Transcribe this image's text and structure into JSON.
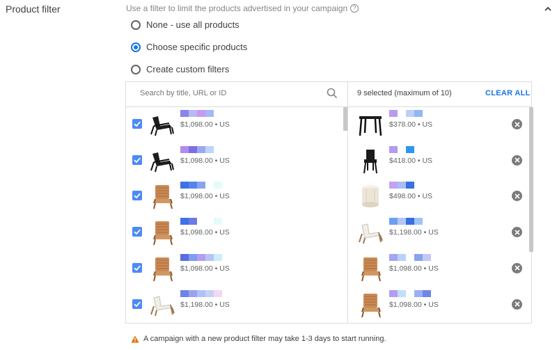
{
  "section": {
    "label": "Product filter",
    "help_text": "Use a filter to limit the products advertised in your campaign"
  },
  "radios": [
    {
      "label": "None - use all products",
      "selected": false
    },
    {
      "label": "Choose specific products",
      "selected": true
    },
    {
      "label": "Create custom filters",
      "selected": false
    }
  ],
  "search": {
    "placeholder": "Search by title, URL or ID"
  },
  "selection": {
    "count_text": "9 selected (maximum of 10)",
    "clear_all": "CLEAR ALL"
  },
  "left_items": [
    {
      "price": "$1,098.00 • US",
      "icon": "black-chair-icon",
      "checked": true,
      "swatches": [
        "#8a85e8",
        "#b6b9f3",
        "#c79af0",
        "#a7b8f7"
      ]
    },
    {
      "price": "$1,098.00 • US",
      "icon": "black-chair-icon",
      "checked": true,
      "swatches": [
        "#b38bf0",
        "#7d6fe0",
        "#9aa8f4",
        "#bcd6fb"
      ]
    },
    {
      "price": "$1,098.00 • US",
      "icon": "woven-chair-icon",
      "checked": true,
      "swatches": [
        "#3f72e4",
        "#5684ea",
        "#8ba3ef",
        "#ffffff",
        "#e4fbfa"
      ]
    },
    {
      "price": "$1,098.00 • US",
      "icon": "woven-chair-icon",
      "checked": true,
      "swatches": [
        "#3f72e4",
        "#6b7be6",
        "#ffffff",
        "#ffffff",
        "#e4fbfa"
      ]
    },
    {
      "price": "$1,098.00 • US",
      "icon": "woven-chair-icon",
      "checked": true,
      "swatches": [
        "#5a6ee0",
        "#7f9cf0",
        "#b49ef2",
        "#b8c2f7",
        "#cceefc"
      ]
    },
    {
      "price": "$1,198.00 • US",
      "icon": "white-chair-icon",
      "checked": true,
      "swatches": [
        "#6b84e8",
        "#9aa3f0",
        "#b0c3f5",
        "#c7d0f9",
        "#f4d8f2"
      ]
    }
  ],
  "right_items": [
    {
      "price": "$378.00 • US",
      "icon": "black-table-icon",
      "swatches": [
        "#b89cf2",
        "#ffffff",
        "#bcd0f8",
        "#8fb8f5"
      ]
    },
    {
      "price": "$418.00 • US",
      "icon": "black-side-chair-icon",
      "swatches": [
        "#b49af0",
        "#ffffff",
        "#2d96f0"
      ]
    },
    {
      "price": "$498.00 • US",
      "icon": "white-round-ottoman-icon",
      "swatches": [
        "#c2a2f3",
        "#a8bcf6",
        "#3a6fe0"
      ]
    },
    {
      "price": "$1,198.00 • US",
      "icon": "white-chair-icon",
      "swatches": [
        "#6aa0f0",
        "#b5c6f5",
        "#3a6fe0",
        "#9ec4f7"
      ]
    },
    {
      "price": "$1,098.00 • US",
      "icon": "woven-chair-icon",
      "swatches": [
        "#a7a3f2",
        "#b8d2f8",
        "#ffffff",
        "#8ba3ef",
        "#c3c9f7"
      ]
    },
    {
      "price": "$1,098.00 • US",
      "icon": "woven-chair-icon",
      "swatches": [
        "#b59cf2",
        "#bfe0f9",
        "#ffffff",
        "#9ab0f4",
        "#6f86e6"
      ]
    }
  ],
  "warning": {
    "text": "A campaign with a new product filter may take 1-3 days to start running."
  },
  "colors": {
    "accent": "#1a73e8",
    "checkbox": "#4c8bf5",
    "warning": "#e37400"
  }
}
